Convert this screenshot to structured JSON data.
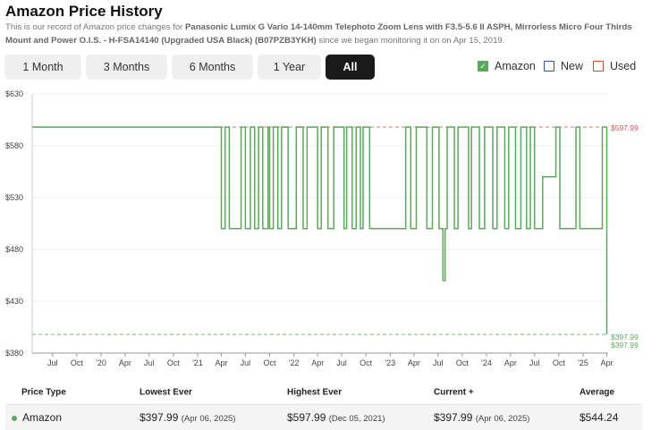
{
  "header": {
    "title": "Amazon Price History",
    "desc_prefix": "This is our record of Amazon price changes for ",
    "product": "Panasonic Lumix G Vario 14-140mm Telephoto Zoom Lens with F3.5-5.6 II ASPH, Mirrorless Micro Four Thirds Mount and Power O.I.S. - H-FSA14140 (Upgraded USA Black) (B07PZB3YKH)",
    "desc_suffix": " since we began monitoring it on on Apr 15, 2019."
  },
  "range_buttons": [
    {
      "label": "1 Month",
      "active": false
    },
    {
      "label": "3 Months",
      "active": false
    },
    {
      "label": "6 Months",
      "active": false
    },
    {
      "label": "1 Year",
      "active": false
    },
    {
      "label": "All",
      "active": true
    }
  ],
  "legend": [
    {
      "label": "Amazon",
      "color": "#5ba85b",
      "checked": true
    },
    {
      "label": "New",
      "color": "#2d4fa8",
      "checked": false
    },
    {
      "label": "Used",
      "color": "#b5532d",
      "checked": false
    }
  ],
  "chart_data": {
    "type": "line",
    "title": "",
    "xlabel": "",
    "ylabel": "",
    "ylim": [
      380,
      630
    ],
    "xlim": [
      "2019-04-15",
      "2025-04-06"
    ],
    "grid": true,
    "y_ticks": [
      "$630",
      "$580",
      "$530",
      "$480",
      "$430",
      "$380"
    ],
    "y_tick_values": [
      630,
      580,
      530,
      480,
      430,
      380
    ],
    "x_ticks": [
      {
        "label": "Jul",
        "date": "2019-07-01"
      },
      {
        "label": "Oct",
        "date": "2019-10-01"
      },
      {
        "label": "'20",
        "date": "2020-01-01"
      },
      {
        "label": "Apr",
        "date": "2020-04-01"
      },
      {
        "label": "Jul",
        "date": "2020-07-01"
      },
      {
        "label": "Oct",
        "date": "2020-10-01"
      },
      {
        "label": "'21",
        "date": "2021-01-01"
      },
      {
        "label": "Apr",
        "date": "2021-04-01"
      },
      {
        "label": "Jul",
        "date": "2021-07-01"
      },
      {
        "label": "Oct",
        "date": "2021-10-01"
      },
      {
        "label": "'22",
        "date": "2022-01-01"
      },
      {
        "label": "Apr",
        "date": "2022-04-01"
      },
      {
        "label": "Jul",
        "date": "2022-07-01"
      },
      {
        "label": "Oct",
        "date": "2022-10-01"
      },
      {
        "label": "'23",
        "date": "2023-01-01"
      },
      {
        "label": "Apr",
        "date": "2023-04-01"
      },
      {
        "label": "Jul",
        "date": "2023-07-01"
      },
      {
        "label": "Oct",
        "date": "2023-10-01"
      },
      {
        "label": "'24",
        "date": "2024-01-01"
      },
      {
        "label": "Apr",
        "date": "2024-04-01"
      },
      {
        "label": "Jul",
        "date": "2024-07-01"
      },
      {
        "label": "Oct",
        "date": "2024-10-01"
      },
      {
        "label": "'25",
        "date": "2025-01-01"
      },
      {
        "label": "Apr",
        "date": "2025-04-01"
      }
    ],
    "series": [
      {
        "color": "#5ba85b",
        "points": [
          {
            "date": "2019-04-15",
            "price": 597.99
          },
          {
            "date": "2021-04-01",
            "price": 597.99
          },
          {
            "date": "2021-04-01",
            "price": 499.99
          },
          {
            "date": "2021-04-15",
            "price": 499.99
          },
          {
            "date": "2021-04-15",
            "price": 597.99
          },
          {
            "date": "2021-05-01",
            "price": 597.99
          },
          {
            "date": "2021-05-01",
            "price": 499.99
          },
          {
            "date": "2021-06-15",
            "price": 499.99
          },
          {
            "date": "2021-06-15",
            "price": 597.99
          },
          {
            "date": "2021-07-01",
            "price": 597.99
          },
          {
            "date": "2021-07-01",
            "price": 499.99
          },
          {
            "date": "2021-07-20",
            "price": 499.99
          },
          {
            "date": "2021-07-20",
            "price": 597.99
          },
          {
            "date": "2021-08-05",
            "price": 597.99
          },
          {
            "date": "2021-08-05",
            "price": 499.99
          },
          {
            "date": "2021-08-20",
            "price": 499.99
          },
          {
            "date": "2021-08-20",
            "price": 597.99
          },
          {
            "date": "2021-09-05",
            "price": 597.99
          },
          {
            "date": "2021-09-05",
            "price": 499.99
          },
          {
            "date": "2021-09-25",
            "price": 499.99
          },
          {
            "date": "2021-09-25",
            "price": 597.99
          },
          {
            "date": "2021-10-01",
            "price": 597.99
          },
          {
            "date": "2021-10-01",
            "price": 499.99
          },
          {
            "date": "2021-10-15",
            "price": 499.99
          },
          {
            "date": "2021-10-15",
            "price": 597.99
          },
          {
            "date": "2021-11-01",
            "price": 597.99
          },
          {
            "date": "2021-11-01",
            "price": 499.99
          },
          {
            "date": "2021-11-15",
            "price": 499.99
          },
          {
            "date": "2021-11-15",
            "price": 597.99
          },
          {
            "date": "2021-12-10",
            "price": 597.99
          },
          {
            "date": "2021-12-10",
            "price": 499.99
          },
          {
            "date": "2022-01-10",
            "price": 499.99
          },
          {
            "date": "2022-01-10",
            "price": 597.99
          },
          {
            "date": "2022-02-05",
            "price": 597.99
          },
          {
            "date": "2022-02-05",
            "price": 499.99
          },
          {
            "date": "2022-02-20",
            "price": 499.99
          },
          {
            "date": "2022-02-20",
            "price": 597.99
          },
          {
            "date": "2022-04-01",
            "price": 597.99
          },
          {
            "date": "2022-04-01",
            "price": 499.99
          },
          {
            "date": "2022-04-15",
            "price": 499.99
          },
          {
            "date": "2022-04-15",
            "price": 597.99
          },
          {
            "date": "2022-05-10",
            "price": 597.99
          },
          {
            "date": "2022-05-10",
            "price": 499.99
          },
          {
            "date": "2022-06-01",
            "price": 499.99
          },
          {
            "date": "2022-06-01",
            "price": 597.99
          },
          {
            "date": "2022-07-10",
            "price": 597.99
          },
          {
            "date": "2022-07-10",
            "price": 499.99
          },
          {
            "date": "2022-07-20",
            "price": 499.99
          },
          {
            "date": "2022-07-20",
            "price": 597.99
          },
          {
            "date": "2022-08-10",
            "price": 597.99
          },
          {
            "date": "2022-08-10",
            "price": 499.99
          },
          {
            "date": "2022-08-25",
            "price": 499.99
          },
          {
            "date": "2022-08-25",
            "price": 597.99
          },
          {
            "date": "2022-09-10",
            "price": 597.99
          },
          {
            "date": "2022-09-10",
            "price": 499.99
          },
          {
            "date": "2022-09-20",
            "price": 499.99
          },
          {
            "date": "2022-09-20",
            "price": 597.99
          },
          {
            "date": "2022-10-15",
            "price": 597.99
          },
          {
            "date": "2022-10-15",
            "price": 499.99
          },
          {
            "date": "2023-03-01",
            "price": 499.99
          },
          {
            "date": "2023-03-01",
            "price": 597.99
          },
          {
            "date": "2023-03-20",
            "price": 597.99
          },
          {
            "date": "2023-03-20",
            "price": 499.99
          },
          {
            "date": "2023-04-10",
            "price": 499.99
          },
          {
            "date": "2023-04-10",
            "price": 597.99
          },
          {
            "date": "2023-05-20",
            "price": 597.99
          },
          {
            "date": "2023-05-20",
            "price": 499.99
          },
          {
            "date": "2023-06-10",
            "price": 499.99
          },
          {
            "date": "2023-06-10",
            "price": 597.99
          },
          {
            "date": "2023-07-05",
            "price": 597.99
          },
          {
            "date": "2023-07-05",
            "price": 499.99
          },
          {
            "date": "2023-07-20",
            "price": 499.99
          },
          {
            "date": "2023-07-20",
            "price": 449.99
          },
          {
            "date": "2023-07-28",
            "price": 449.99
          },
          {
            "date": "2023-07-28",
            "price": 499.99
          },
          {
            "date": "2023-08-05",
            "price": 499.99
          },
          {
            "date": "2023-08-05",
            "price": 597.99
          },
          {
            "date": "2023-09-01",
            "price": 597.99
          },
          {
            "date": "2023-09-01",
            "price": 499.99
          },
          {
            "date": "2023-09-15",
            "price": 499.99
          },
          {
            "date": "2023-09-15",
            "price": 597.99
          },
          {
            "date": "2023-10-25",
            "price": 597.99
          },
          {
            "date": "2023-10-25",
            "price": 499.99
          },
          {
            "date": "2023-11-05",
            "price": 499.99
          },
          {
            "date": "2023-11-05",
            "price": 597.99
          },
          {
            "date": "2023-12-05",
            "price": 597.99
          },
          {
            "date": "2023-12-05",
            "price": 499.99
          },
          {
            "date": "2023-12-25",
            "price": 499.99
          },
          {
            "date": "2023-12-25",
            "price": 597.99
          },
          {
            "date": "2024-01-25",
            "price": 597.99
          },
          {
            "date": "2024-01-25",
            "price": 499.99
          },
          {
            "date": "2024-02-10",
            "price": 499.99
          },
          {
            "date": "2024-02-10",
            "price": 597.99
          },
          {
            "date": "2024-03-10",
            "price": 597.99
          },
          {
            "date": "2024-03-10",
            "price": 499.99
          },
          {
            "date": "2024-03-25",
            "price": 499.99
          },
          {
            "date": "2024-03-25",
            "price": 597.99
          },
          {
            "date": "2024-04-20",
            "price": 597.99
          },
          {
            "date": "2024-04-20",
            "price": 499.99
          },
          {
            "date": "2024-05-10",
            "price": 499.99
          },
          {
            "date": "2024-05-10",
            "price": 597.99
          },
          {
            "date": "2024-06-01",
            "price": 597.99
          },
          {
            "date": "2024-06-01",
            "price": 499.99
          },
          {
            "date": "2024-06-15",
            "price": 499.99
          },
          {
            "date": "2024-06-15",
            "price": 597.99
          },
          {
            "date": "2024-07-01",
            "price": 597.99
          },
          {
            "date": "2024-07-01",
            "price": 499.99
          },
          {
            "date": "2024-08-01",
            "price": 499.99
          },
          {
            "date": "2024-08-01",
            "price": 549.99
          },
          {
            "date": "2024-09-20",
            "price": 549.99
          },
          {
            "date": "2024-09-20",
            "price": 597.99
          },
          {
            "date": "2024-10-05",
            "price": 597.99
          },
          {
            "date": "2024-10-05",
            "price": 499.99
          },
          {
            "date": "2024-12-05",
            "price": 499.99
          },
          {
            "date": "2024-12-05",
            "price": 597.99
          },
          {
            "date": "2024-12-20",
            "price": 597.99
          },
          {
            "date": "2024-12-20",
            "price": 499.99
          },
          {
            "date": "2025-03-15",
            "price": 499.99
          },
          {
            "date": "2025-03-15",
            "price": 597.99
          },
          {
            "date": "2025-04-01",
            "price": 597.99
          },
          {
            "date": "2025-04-01",
            "price": 397.99
          }
        ]
      }
    ],
    "reference_lines": [
      {
        "value": 597.99,
        "label": "$597.99",
        "color": "#d9534f"
      },
      {
        "value": 397.99,
        "label": "$397.99",
        "color": "#5ba85b"
      }
    ],
    "end_label": {
      "value": 397.99,
      "label": "$397.99",
      "color": "#5ba85b"
    }
  },
  "table": {
    "headers": [
      "Price Type",
      "Lowest Ever",
      "Highest Ever",
      "Current +",
      "Average"
    ],
    "rows": [
      {
        "type": "Amazon",
        "dot_color": "#5ba85b",
        "lowest": "$397.99",
        "lowest_date": "(Apr 06, 2025)",
        "highest": "$597.99",
        "highest_date": "(Dec 05, 2021)",
        "current": "$397.99",
        "current_date": "(Apr 06, 2025)",
        "average": "$544.24"
      }
    ]
  }
}
